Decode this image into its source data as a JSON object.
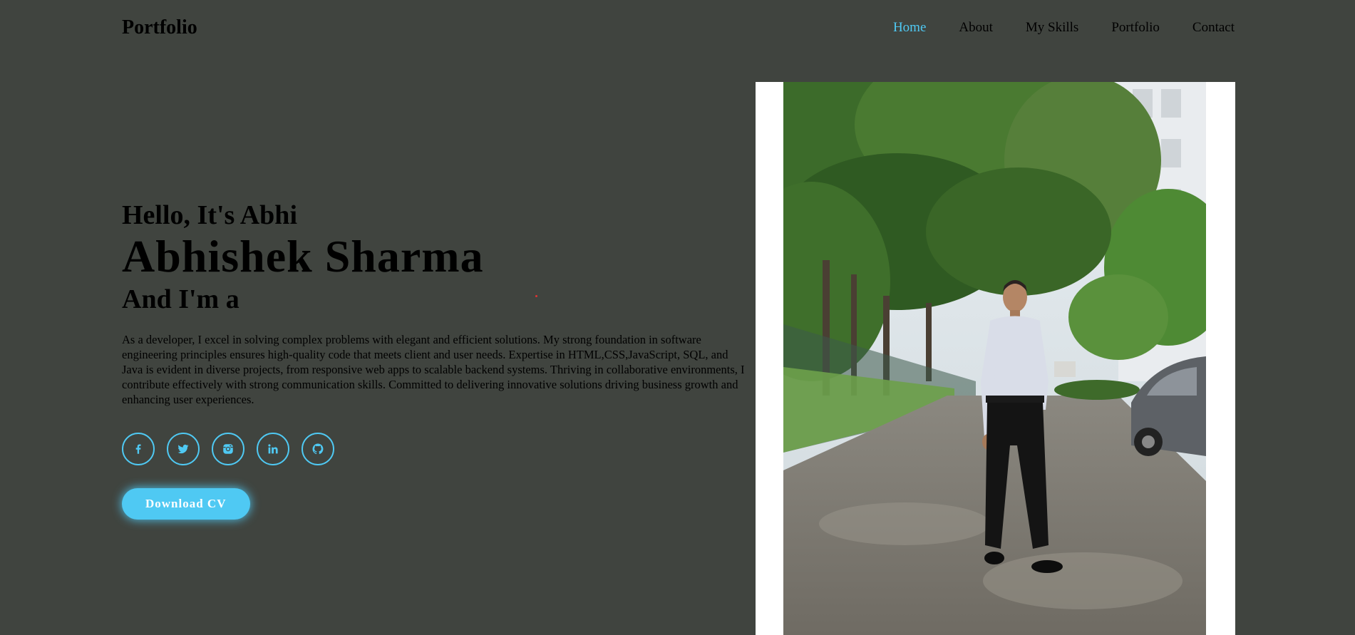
{
  "header": {
    "logo": "Portfolio",
    "nav": [
      {
        "label": "Home",
        "active": true
      },
      {
        "label": "About",
        "active": false
      },
      {
        "label": "My Skills",
        "active": false
      },
      {
        "label": "Portfolio",
        "active": false
      },
      {
        "label": "Contact",
        "active": false
      }
    ]
  },
  "hero": {
    "greeting": "Hello, It's Abhi",
    "name": "Abhishek Sharma",
    "role_prefix": "And I'm a",
    "description": "As a developer, I excel in solving complex problems with elegant and efficient solutions. My strong foundation in software engineering principles ensures high-quality code that meets client and user needs. Expertise in HTML,CSS,JavaScript, SQL, and Java is evident in diverse projects, from responsive web apps to scalable backend systems. Thriving in collaborative environments, I contribute effectively with strong communication skills. Committed to delivering innovative solutions driving business growth and enhancing user experiences.",
    "social": [
      {
        "icon": "facebook-icon"
      },
      {
        "icon": "twitter-icon"
      },
      {
        "icon": "instagram-icon"
      },
      {
        "icon": "linkedin-icon"
      },
      {
        "icon": "github-icon"
      }
    ],
    "cv_button": "Download CV"
  },
  "profile_image": {
    "subject": "person standing on a wet road lined with trees"
  },
  "colors": {
    "background": "#40443f",
    "accent": "#4fc9f3",
    "text": "#000000"
  }
}
